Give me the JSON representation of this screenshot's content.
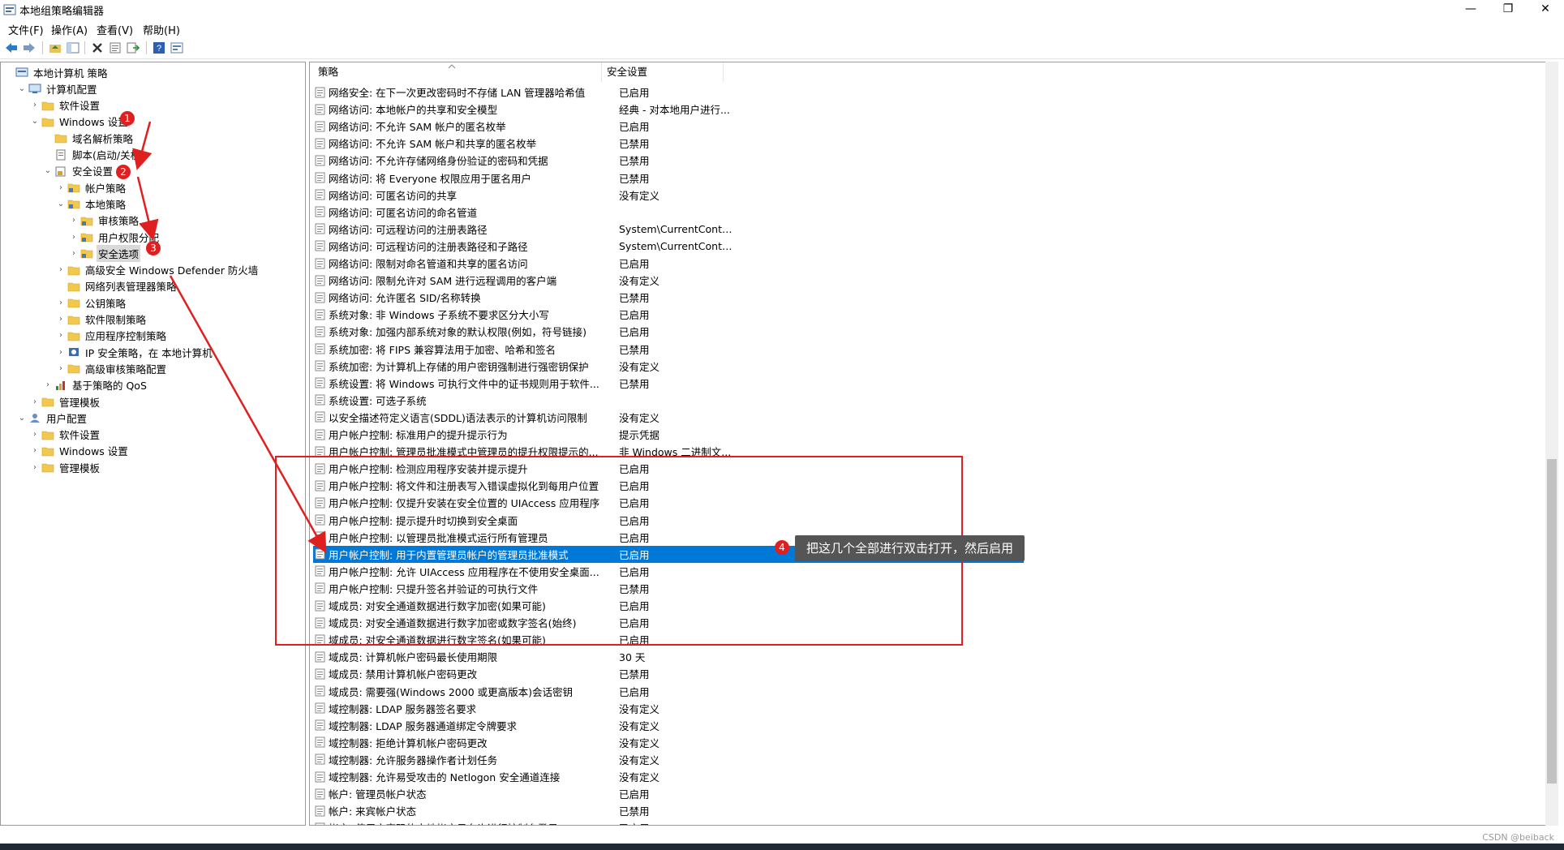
{
  "window": {
    "title": "本地组策略编辑器",
    "minimize": "—",
    "restore": "❐",
    "close": "✕"
  },
  "menu": [
    "文件(F)",
    "操作(A)",
    "查看(V)",
    "帮助(H)"
  ],
  "tree": [
    {
      "label": "本地计算机 策略",
      "depth": 0,
      "arrow": "",
      "icon": "policy-icon"
    },
    {
      "label": "计算机配置",
      "depth": 1,
      "arrow": "v",
      "icon": "computer-icon"
    },
    {
      "label": "软件设置",
      "depth": 2,
      "arrow": ">",
      "icon": "folder-icon"
    },
    {
      "label": "Windows 设置",
      "depth": 2,
      "arrow": "v",
      "icon": "folder-icon"
    },
    {
      "label": "域名解析策略",
      "depth": 3,
      "arrow": "",
      "icon": "folder-icon"
    },
    {
      "label": "脚本(启动/关机)",
      "depth": 3,
      "arrow": "",
      "icon": "script-icon"
    },
    {
      "label": "安全设置",
      "depth": 3,
      "arrow": "v",
      "icon": "security-icon"
    },
    {
      "label": "帐户策略",
      "depth": 4,
      "arrow": ">",
      "icon": "security-folder-icon"
    },
    {
      "label": "本地策略",
      "depth": 4,
      "arrow": "v",
      "icon": "security-folder-icon"
    },
    {
      "label": "审核策略",
      "depth": 5,
      "arrow": ">",
      "icon": "security-folder-icon"
    },
    {
      "label": "用户权限分配",
      "depth": 5,
      "arrow": ">",
      "icon": "security-folder-icon"
    },
    {
      "label": "安全选项",
      "depth": 5,
      "arrow": ">",
      "icon": "security-folder-icon",
      "selected": true
    },
    {
      "label": "高级安全 Windows Defender 防火墙",
      "depth": 4,
      "arrow": ">",
      "icon": "folder-icon"
    },
    {
      "label": "网络列表管理器策略",
      "depth": 4,
      "arrow": "",
      "icon": "folder-icon"
    },
    {
      "label": "公钥策略",
      "depth": 4,
      "arrow": ">",
      "icon": "folder-icon"
    },
    {
      "label": "软件限制策略",
      "depth": 4,
      "arrow": ">",
      "icon": "folder-icon"
    },
    {
      "label": "应用程序控制策略",
      "depth": 4,
      "arrow": ">",
      "icon": "folder-icon"
    },
    {
      "label": "IP 安全策略，在 本地计算机",
      "depth": 4,
      "arrow": ">",
      "icon": "ipsec-icon"
    },
    {
      "label": "高级审核策略配置",
      "depth": 4,
      "arrow": ">",
      "icon": "folder-icon"
    },
    {
      "label": "基于策略的 QoS",
      "depth": 3,
      "arrow": ">",
      "icon": "chart-icon"
    },
    {
      "label": "管理模板",
      "depth": 2,
      "arrow": ">",
      "icon": "folder-icon"
    },
    {
      "label": "用户配置",
      "depth": 1,
      "arrow": "v",
      "icon": "user-icon"
    },
    {
      "label": "软件设置",
      "depth": 2,
      "arrow": ">",
      "icon": "folder-icon"
    },
    {
      "label": "Windows 设置",
      "depth": 2,
      "arrow": ">",
      "icon": "folder-icon"
    },
    {
      "label": "管理模板",
      "depth": 2,
      "arrow": ">",
      "icon": "folder-icon"
    }
  ],
  "columns": {
    "policy": "策略",
    "setting": "安全设置"
  },
  "rows": [
    {
      "policy": "网络安全: 在下一次更改密码时不存储 LAN 管理器哈希值",
      "value": "已启用"
    },
    {
      "policy": "网络访问: 本地帐户的共享和安全模型",
      "value": "经典 - 对本地用户进行..."
    },
    {
      "policy": "网络访问: 不允许 SAM 帐户的匿名枚举",
      "value": "已启用"
    },
    {
      "policy": "网络访问: 不允许 SAM 帐户和共享的匿名枚举",
      "value": "已禁用"
    },
    {
      "policy": "网络访问: 不允许存储网络身份验证的密码和凭据",
      "value": "已禁用"
    },
    {
      "policy": "网络访问: 将 Everyone 权限应用于匿名用户",
      "value": "已禁用"
    },
    {
      "policy": "网络访问: 可匿名访问的共享",
      "value": "没有定义"
    },
    {
      "policy": "网络访问: 可匿名访问的命名管道",
      "value": ""
    },
    {
      "policy": "网络访问: 可远程访问的注册表路径",
      "value": "System\\CurrentContro..."
    },
    {
      "policy": "网络访问: 可远程访问的注册表路径和子路径",
      "value": "System\\CurrentContro..."
    },
    {
      "policy": "网络访问: 限制对命名管道和共享的匿名访问",
      "value": "已启用"
    },
    {
      "policy": "网络访问: 限制允许对 SAM 进行远程调用的客户端",
      "value": "没有定义"
    },
    {
      "policy": "网络访问: 允许匿名 SID/名称转换",
      "value": "已禁用"
    },
    {
      "policy": "系统对象: 非 Windows 子系统不要求区分大小写",
      "value": "已启用"
    },
    {
      "policy": "系统对象: 加强内部系统对象的默认权限(例如，符号链接)",
      "value": "已启用"
    },
    {
      "policy": "系统加密: 将 FIPS 兼容算法用于加密、哈希和签名",
      "value": "已禁用"
    },
    {
      "policy": "系统加密: 为计算机上存储的用户密钥强制进行强密钥保护",
      "value": "没有定义"
    },
    {
      "policy": "系统设置: 将 Windows 可执行文件中的证书规则用于软件...",
      "value": "已禁用"
    },
    {
      "policy": "系统设置: 可选子系统",
      "value": ""
    },
    {
      "policy": "以安全描述符定义语言(SDDL)语法表示的计算机访问限制",
      "value": "没有定义"
    },
    {
      "policy": "用户帐户控制: 标准用户的提升提示行为",
      "value": "提示凭据"
    },
    {
      "policy": "用户帐户控制: 管理员批准模式中管理员的提升权限提示的...",
      "value": "非 Windows 二进制文..."
    },
    {
      "policy": "用户帐户控制: 检测应用程序安装并提示提升",
      "value": "已启用"
    },
    {
      "policy": "用户帐户控制: 将文件和注册表写入错误虚拟化到每用户位置",
      "value": "已启用"
    },
    {
      "policy": "用户帐户控制: 仅提升安装在安全位置的 UIAccess 应用程序",
      "value": "已启用"
    },
    {
      "policy": "用户帐户控制: 提示提升时切换到安全桌面",
      "value": "已启用"
    },
    {
      "policy": "用户帐户控制: 以管理员批准模式运行所有管理员",
      "value": "已启用"
    },
    {
      "policy": "用户帐户控制: 用于内置管理员帐户的管理员批准模式",
      "value": "已启用",
      "selected": true
    },
    {
      "policy": "用户帐户控制: 允许 UIAccess 应用程序在不使用安全桌面...",
      "value": "已启用"
    },
    {
      "policy": "用户帐户控制: 只提升签名并验证的可执行文件",
      "value": "已禁用"
    },
    {
      "policy": "域成员: 对安全通道数据进行数字加密(如果可能)",
      "value": "已启用"
    },
    {
      "policy": "域成员: 对安全通道数据进行数字加密或数字签名(始终)",
      "value": "已启用"
    },
    {
      "policy": "域成员: 对安全通道数据进行数字签名(如果可能)",
      "value": "已启用"
    },
    {
      "policy": "域成员: 计算机帐户密码最长使用期限",
      "value": "30 天"
    },
    {
      "policy": "域成员: 禁用计算机帐户密码更改",
      "value": "已禁用"
    },
    {
      "policy": "域成员: 需要强(Windows 2000 或更高版本)会话密钥",
      "value": "已启用"
    },
    {
      "policy": "域控制器: LDAP 服务器签名要求",
      "value": "没有定义"
    },
    {
      "policy": "域控制器: LDAP 服务器通道绑定令牌要求",
      "value": "没有定义"
    },
    {
      "policy": "域控制器: 拒绝计算机帐户密码更改",
      "value": "没有定义"
    },
    {
      "policy": "域控制器: 允许服务器操作者计划任务",
      "value": "没有定义"
    },
    {
      "policy": "域控制器: 允许易受攻击的 Netlogon 安全通道连接",
      "value": "没有定义"
    },
    {
      "policy": "帐户: 管理员帐户状态",
      "value": "已启用"
    },
    {
      "policy": "帐户: 来宾帐户状态",
      "value": "已禁用"
    },
    {
      "policy": "帐户: 使用空密码的本地帐户只允许进行控制台登录",
      "value": "已启用"
    }
  ],
  "annotations": {
    "badges": [
      "1",
      "2",
      "3",
      "4"
    ],
    "callout": "把这几个全部进行双击打开，然后启用",
    "color": "#e02020"
  },
  "watermark": "CSDN @beiback"
}
